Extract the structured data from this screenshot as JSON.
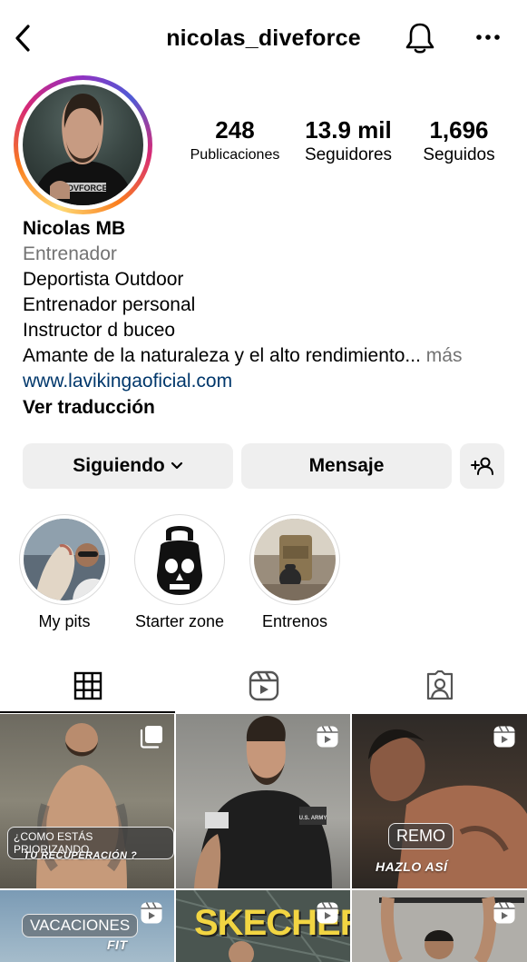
{
  "header": {
    "username": "nicolas_diveforce",
    "icons": {
      "back": "chevron-left-icon",
      "notifications": "bell-icon",
      "more": "more-horizontal-icon"
    }
  },
  "profile": {
    "avatar_shirt_text": "ODVFORCE",
    "stats": [
      {
        "value": "248",
        "label": "Publicaciones"
      },
      {
        "value": "13.9 mil",
        "label": "Seguidores"
      },
      {
        "value": "1,696",
        "label": "Seguidos"
      }
    ]
  },
  "bio": {
    "name": "Nicolas MB",
    "category": "Entrenador",
    "lines": [
      "Deportista Outdoor",
      "Entrenador personal",
      "Instructor d buceo"
    ],
    "last_line": "Amante de la naturaleza y el alto rendimiento...",
    "more_label": "más",
    "link": "www.lavikingaoficial.com",
    "translate_label": "Ver traducción"
  },
  "actions": {
    "following_label": "Siguiendo",
    "message_label": "Mensaje",
    "add_person_icon": "add-person-icon"
  },
  "highlights": [
    {
      "label": "My pits"
    },
    {
      "label": "Starter zone"
    },
    {
      "label": "Entrenos"
    }
  ],
  "tabs": [
    {
      "icon": "grid-icon",
      "active": true
    },
    {
      "icon": "reels-icon",
      "active": false
    },
    {
      "icon": "tagged-icon",
      "active": false
    }
  ],
  "posts": [
    {
      "caption_pill": "¿COMO ESTÁS PRIORIZANDO",
      "caption_text": "TU RECUPERACIÓN ?",
      "badge": "carousel-icon"
    },
    {
      "shirt_text": "U.S. ARMY",
      "badge": "reel-icon"
    },
    {
      "caption_pill": "REMO",
      "caption_text": "HAZLO ASÍ",
      "badge": "reel-icon"
    },
    {
      "caption_pill": "VACACIONES",
      "caption_text": "FIT",
      "badge": "reel-icon"
    },
    {
      "caption_text": "SKECHERS",
      "badge": "reel-icon"
    },
    {
      "badge": "reel-icon"
    }
  ],
  "colors": {
    "link": "#00376b",
    "muted": "#737373",
    "button_bg": "#efefef"
  }
}
